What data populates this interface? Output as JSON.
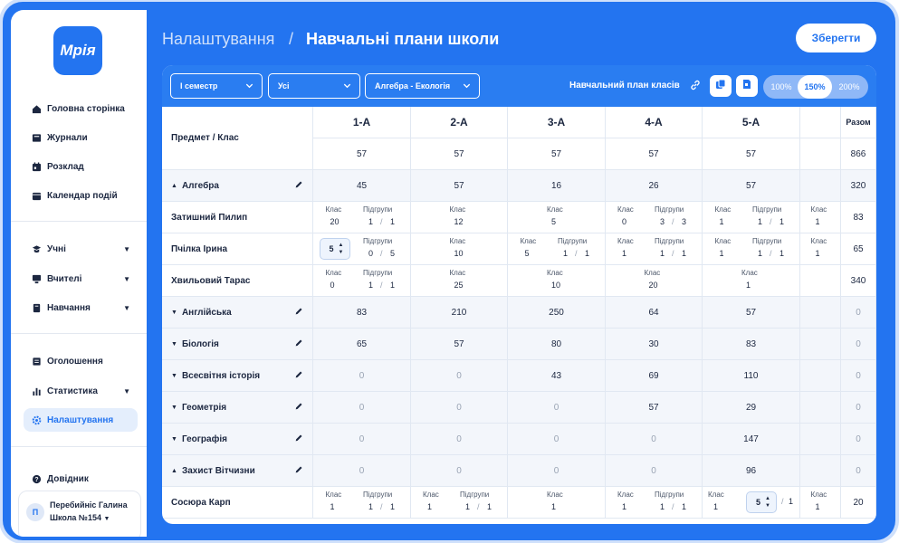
{
  "sidebar": {
    "logo": "Мрія",
    "items": [
      {
        "label": "Головна сторінка"
      },
      {
        "label": "Журнали"
      },
      {
        "label": "Розклад"
      },
      {
        "label": "Календар подій"
      },
      {
        "label": "Учні"
      },
      {
        "label": "Вчителі"
      },
      {
        "label": "Навчання"
      },
      {
        "label": "Оголошення"
      },
      {
        "label": "Статистика"
      },
      {
        "label": "Налаштування"
      },
      {
        "label": "Довідник"
      }
    ],
    "user": {
      "initial": "П",
      "name": "Перебийніс Галина",
      "school": "Школа №154"
    }
  },
  "header": {
    "crumb": "Налаштування",
    "sep": "/",
    "title": "Навчальні плани школи",
    "save": "Зберегти"
  },
  "toolbar": {
    "semester": "І семестр",
    "scope": "Усі",
    "subjects": "Алгебра - Екологія",
    "plan_link": "Навчальний план класів",
    "zoom": [
      "100%",
      "150%",
      "200%"
    ],
    "zoom_selected": "150%"
  },
  "table": {
    "corner": "Предмет / Клас",
    "classes": [
      "1-А",
      "2-А",
      "3-А",
      "4-А",
      "5-А"
    ],
    "total_header": "Разом",
    "totals": [
      "57",
      "57",
      "57",
      "57",
      "57",
      "",
      "866"
    ],
    "sub_class": "Клас",
    "sub_groups": "Підгрупи",
    "rows": [
      {
        "label": "Алгебра",
        "vals": [
          "45",
          "57",
          "16",
          "26",
          "57",
          "",
          "320"
        ]
      },
      {
        "label": "Затишний Пилип",
        "total": "83",
        "c1": {
          "k": "20",
          "a": "1",
          "b": "1"
        },
        "c2": "12",
        "c3": "5",
        "c4": {
          "k": "0",
          "a": "3",
          "b": "3"
        },
        "c5": {
          "k": "1",
          "a": "1",
          "b": "1"
        },
        "c6": "1"
      },
      {
        "label": "Пчілка Ірина",
        "total": "65",
        "c1": {
          "k": "5",
          "a": "0",
          "b": "5"
        },
        "c2": "10",
        "c3": {
          "k": "5",
          "a": "1",
          "b": "1"
        },
        "c4": {
          "k": "1",
          "a": "1",
          "b": "1"
        },
        "c5": {
          "k": "1",
          "a": "1",
          "b": "1"
        },
        "c6": "1"
      },
      {
        "label": "Хвильовий Тарас",
        "total": "340",
        "c1": {
          "k": "0",
          "a": "1",
          "b": "1"
        },
        "c2": "25",
        "c3": "10",
        "c4": "20",
        "c5": "1"
      },
      {
        "label": "Англійська",
        "vals": [
          "83",
          "210",
          "250",
          "64",
          "57",
          "",
          "0"
        ]
      },
      {
        "label": "Біологія",
        "vals": [
          "65",
          "57",
          "80",
          "30",
          "83",
          "",
          "0"
        ]
      },
      {
        "label": "Всесвітня історія",
        "vals": [
          "0",
          "0",
          "43",
          "69",
          "110",
          "",
          "0"
        ]
      },
      {
        "label": "Геометрія",
        "vals": [
          "0",
          "0",
          "0",
          "57",
          "29",
          "",
          "0"
        ]
      },
      {
        "label": "Географія",
        "vals": [
          "0",
          "0",
          "0",
          "0",
          "147",
          "",
          "0"
        ]
      },
      {
        "label": "Захист Вітчизни",
        "vals": [
          "0",
          "0",
          "0",
          "0",
          "96",
          "",
          "0"
        ]
      },
      {
        "label": "Сосюра Карп",
        "total": "20",
        "c1": {
          "k": "1",
          "a": "1",
          "b": "1"
        },
        "c2": {
          "k": "1",
          "a": "1",
          "b": "1"
        },
        "c3": "1",
        "c4": {
          "k": "1",
          "a": "1",
          "b": "1"
        },
        "c5": {
          "k": "1",
          "a": "5",
          "b": "1"
        },
        "c6": "1"
      }
    ]
  },
  "colors": {
    "brand": "#2374f0",
    "panel": "#ffffff",
    "row_shade": "#f3f6fb"
  }
}
